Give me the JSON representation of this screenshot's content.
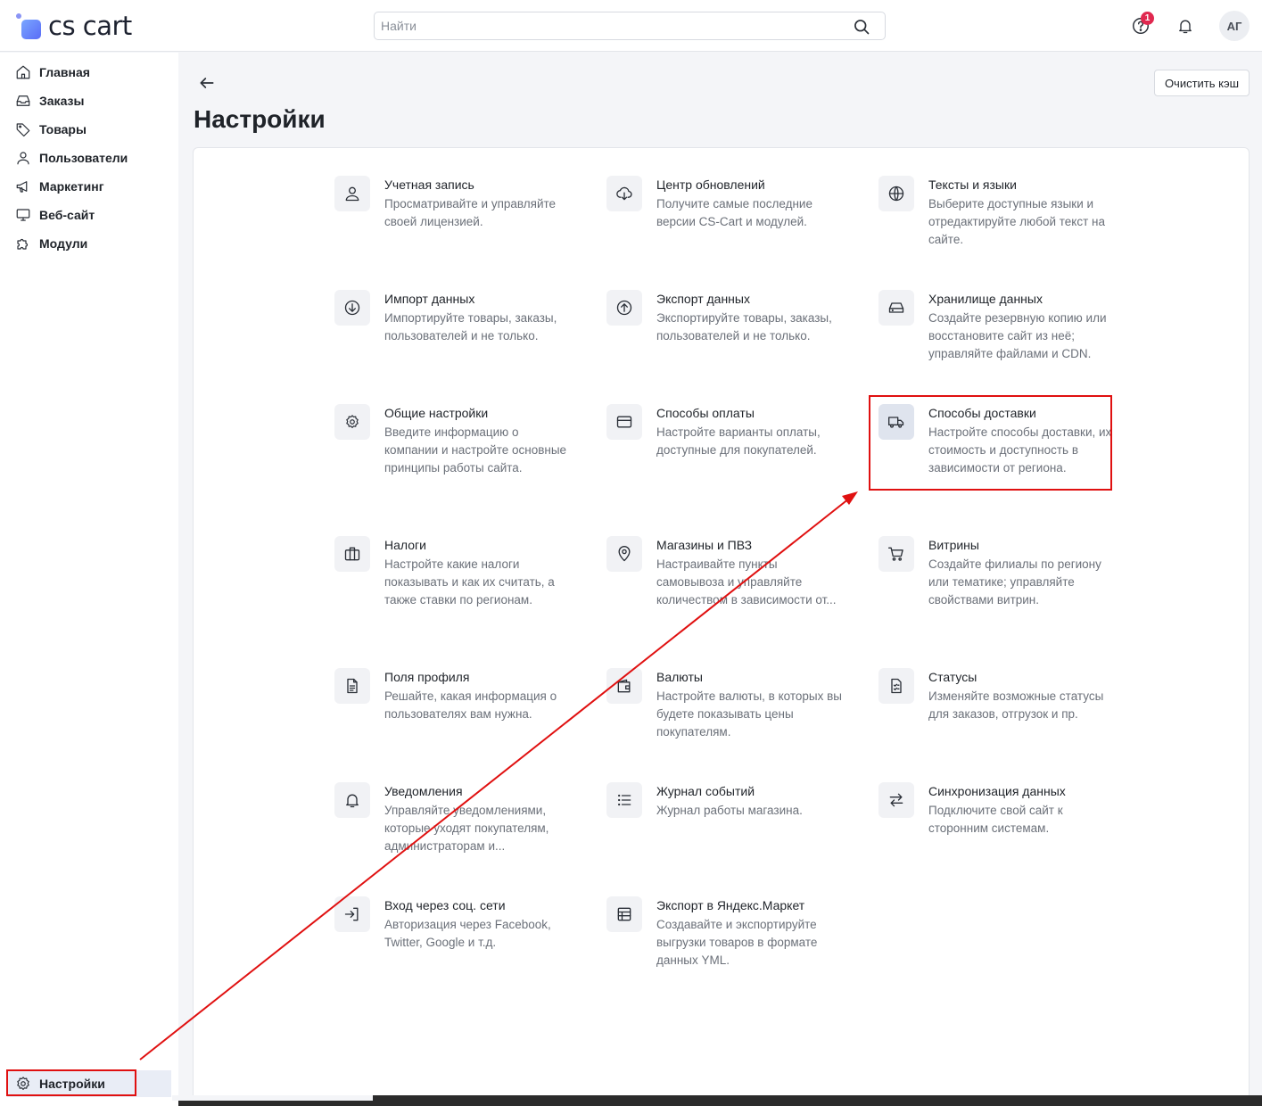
{
  "header": {
    "logo_text": "cs cart",
    "search_placeholder": "Найти",
    "help_badge": "1",
    "avatar_initials": "АГ"
  },
  "sidebar": {
    "items": [
      {
        "label": "Главная",
        "icon": "home-icon"
      },
      {
        "label": "Заказы",
        "icon": "inbox-icon"
      },
      {
        "label": "Товары",
        "icon": "tag-icon"
      },
      {
        "label": "Пользователи",
        "icon": "user-icon"
      },
      {
        "label": "Маркетинг",
        "icon": "megaphone-icon"
      },
      {
        "label": "Веб-сайт",
        "icon": "monitor-icon"
      },
      {
        "label": "Модули",
        "icon": "puzzle-icon"
      }
    ],
    "settings_label": "Настройки"
  },
  "main": {
    "title": "Настройки",
    "clear_cache_label": "Очистить кэш",
    "cards": [
      {
        "title": "Учетная запись",
        "desc": "Просматривайте и управляйте своей лицензией.",
        "icon": "user-icon"
      },
      {
        "title": "Центр обновлений",
        "desc": "Получите самые последние версии CS-Cart и модулей.",
        "icon": "cloud-download-icon"
      },
      {
        "title": "Тексты и языки",
        "desc": "Выберите доступные языки и отредактируйте любой текст на сайте.",
        "icon": "globe-icon"
      },
      {
        "title": "Импорт данных",
        "desc": "Импортируйте товары, заказы, пользователей и не только.",
        "icon": "arrow-down-circle-icon"
      },
      {
        "title": "Экспорт данных",
        "desc": "Экспортируйте товары, заказы, пользователей и не только.",
        "icon": "arrow-up-circle-icon"
      },
      {
        "title": "Хранилище данных",
        "desc": "Создайте резервную копию или восстановите сайт из неё; управляйте файлами и CDN.",
        "icon": "hard-drive-icon"
      },
      {
        "title": "Общие настройки",
        "desc": "Введите информацию о компании и настройте основные принципы работы сайта.",
        "icon": "gear-icon"
      },
      {
        "title": "Способы оплаты",
        "desc": "Настройте варианты оплаты, доступные для покупателей.",
        "icon": "credit-card-icon"
      },
      {
        "title": "Способы доставки",
        "desc": "Настройте способы доставки, их стоимость и доступность в зависимости от региона.",
        "icon": "truck-icon"
      },
      {
        "title": "Налоги",
        "desc": "Настройте какие налоги показывать и как их считать, а также ставки по регионам.",
        "icon": "briefcase-icon"
      },
      {
        "title": "Магазины и ПВЗ",
        "desc": "Настраивайте пункты самовывоза и управляйте количеством в зависимости от...",
        "icon": "map-pin-icon"
      },
      {
        "title": "Витрины",
        "desc": "Создайте филиалы по региону или тематике; управляйте свойствами витрин.",
        "icon": "cart-icon"
      },
      {
        "title": "Поля профиля",
        "desc": "Решайте, какая информация о пользователях вам нужна.",
        "icon": "document-icon"
      },
      {
        "title": "Валюты",
        "desc": "Настройте валюты, в которых вы будете показывать цены покупателям.",
        "icon": "wallet-icon"
      },
      {
        "title": "Статусы",
        "desc": "Изменяйте возможные статусы для заказов, отгрузок и пр.",
        "icon": "checklist-icon"
      },
      {
        "title": "Уведомления",
        "desc": "Управляйте уведомлениями, которые уходят покупателям, администраторам и...",
        "icon": "bell-icon"
      },
      {
        "title": "Журнал событий",
        "desc": "Журнал работы магазина.",
        "icon": "list-icon"
      },
      {
        "title": "Синхронизация данных",
        "desc": "Подключите свой сайт к сторонним системам.",
        "icon": "swap-icon"
      },
      {
        "title": "Вход через соц. сети",
        "desc": "Авторизация через Facebook, Twitter, Google и т.д.",
        "icon": "login-icon"
      },
      {
        "title": "Экспорт в Яндекс.Маркет",
        "desc": "Создавайте и экспортируйте выгрузки товаров в формате данных YML.",
        "icon": "table-icon"
      }
    ]
  },
  "colors": {
    "annotation": "#e01010",
    "badge": "#e0284f",
    "active_bg": "#e9edf6"
  }
}
